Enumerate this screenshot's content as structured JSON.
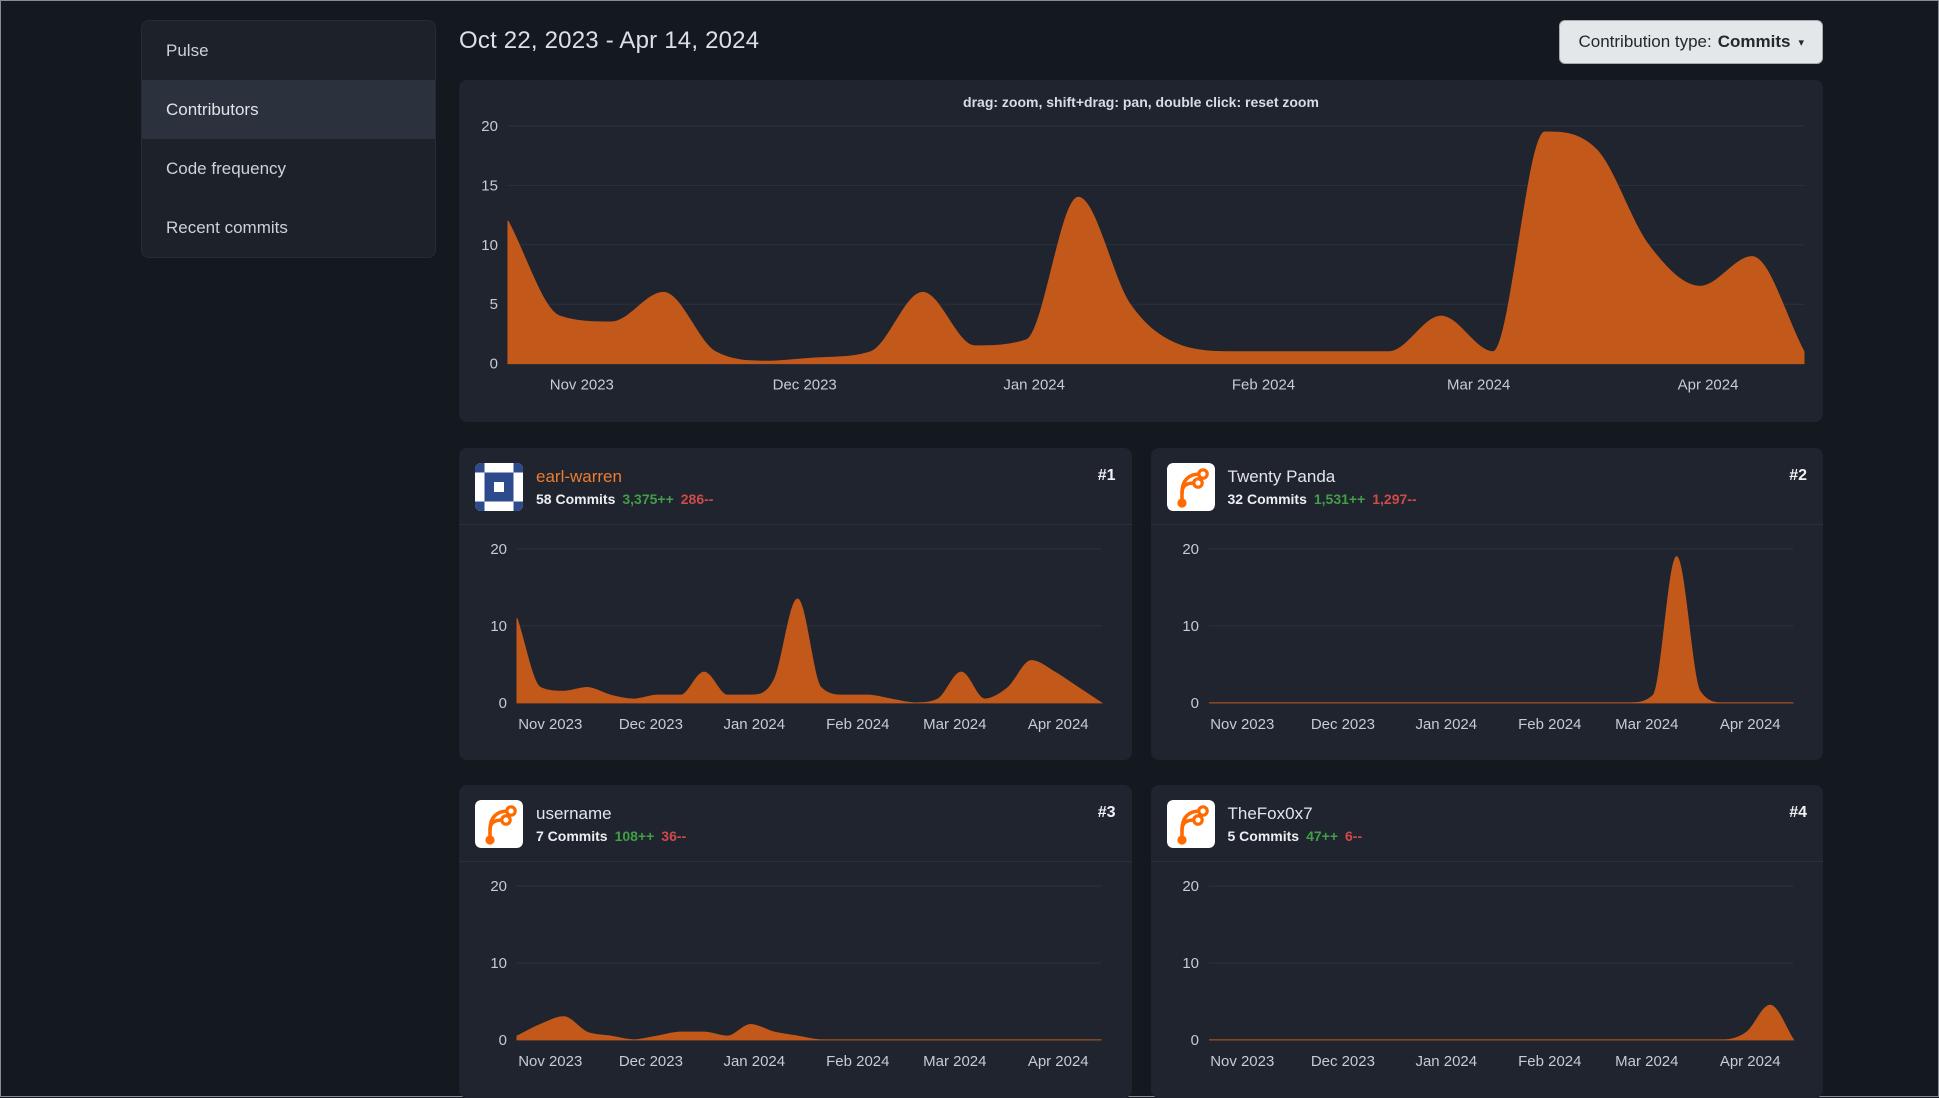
{
  "sidebar": {
    "items": [
      {
        "label": "Pulse"
      },
      {
        "label": "Contributors"
      },
      {
        "label": "Code frequency"
      },
      {
        "label": "Recent commits"
      }
    ],
    "active_item": "Contributors"
  },
  "header": {
    "date_range": "Oct 22, 2023 - Apr 14, 2024",
    "contribution_type_label": "Contribution type:",
    "contribution_type_value": "Commits"
  },
  "contributors": [
    {
      "rank": "#1",
      "name": "earl-warren",
      "commits": "58 Commits",
      "additions": "3,375++",
      "deletions": "286--"
    },
    {
      "rank": "#2",
      "name": "Twenty Panda",
      "commits": "32 Commits",
      "additions": "1,531++",
      "deletions": "1,297--"
    },
    {
      "rank": "#3",
      "name": "username",
      "commits": "7 Commits",
      "additions": "108++",
      "deletions": "36--"
    },
    {
      "rank": "#4",
      "name": "TheFox0x7",
      "commits": "5 Commits",
      "additions": "47++",
      "deletions": "6--"
    }
  ],
  "colors": {
    "page_bg": "#14181f",
    "panel_bg": "#1f242e",
    "grid": "#2c323d",
    "axis_label": "#c6ccd5",
    "chart_fill": "#c2591a",
    "accent_orange": "#ee7b2f",
    "additions_green": "#429e47",
    "deletions_red": "#d04a4a"
  },
  "chart_data": [
    {
      "id": "overall",
      "type": "area",
      "title": "Commits over time (all contributors)",
      "hint": "drag: zoom, shift+drag: pan, double click: reset zoom",
      "period": "Oct 22, 2023 - Apr 14, 2024",
      "interval": "week",
      "values": [
        12,
        4,
        3.5,
        6,
        1,
        0.2,
        0.5,
        1,
        6,
        1.5,
        2,
        14,
        5,
        1.5,
        1,
        1,
        1,
        1,
        4,
        1,
        19.5,
        18,
        10,
        6.5,
        9,
        1
      ],
      "ylim": [
        0,
        20
      ],
      "yticks": [
        0,
        5,
        10,
        15,
        20
      ],
      "xtick_labels": [
        "Nov 2023",
        "Dec 2023",
        "Jan 2024",
        "Feb 2024",
        "Mar 2024",
        "Apr 2024"
      ],
      "xtick_fractions": [
        0.057,
        0.229,
        0.406,
        0.583,
        0.749,
        0.926
      ],
      "fill_color": "#c2591a",
      "grid": true,
      "legend": "none"
    },
    {
      "id": "earl-warren",
      "type": "area",
      "title": "earl-warren weekly commits",
      "interval": "week",
      "values": [
        11,
        2,
        1.5,
        2,
        1,
        0.5,
        1,
        1,
        4,
        1,
        1,
        3,
        13.5,
        2,
        1,
        1,
        0.5,
        0,
        0.5,
        4,
        0.5,
        2,
        5.5,
        4,
        2,
        0
      ],
      "ylim": [
        0,
        20
      ],
      "yticks": [
        0,
        10,
        20
      ],
      "xtick_labels": [
        "Nov 2023",
        "Dec 2023",
        "Jan 2024",
        "Feb 2024",
        "Mar 2024",
        "Apr 2024"
      ],
      "xtick_fractions": [
        0.057,
        0.229,
        0.406,
        0.583,
        0.749,
        0.926
      ],
      "fill_color": "#c2591a",
      "grid": true,
      "legend": "none"
    },
    {
      "id": "twenty-panda",
      "type": "area",
      "title": "Twenty Panda weekly commits",
      "interval": "week",
      "values": [
        0,
        0,
        0,
        0,
        0,
        0,
        0,
        0,
        0,
        0,
        0,
        0,
        0,
        0,
        0,
        0,
        0,
        0,
        0,
        1,
        19,
        1.5,
        0,
        0,
        0,
        0
      ],
      "ylim": [
        0,
        20
      ],
      "yticks": [
        0,
        10,
        20
      ],
      "xtick_labels": [
        "Nov 2023",
        "Dec 2023",
        "Jan 2024",
        "Feb 2024",
        "Mar 2024",
        "Apr 2024"
      ],
      "xtick_fractions": [
        0.057,
        0.229,
        0.406,
        0.583,
        0.749,
        0.926
      ],
      "fill_color": "#c2591a",
      "grid": true,
      "legend": "none"
    },
    {
      "id": "username",
      "type": "area",
      "title": "username weekly commits",
      "interval": "week",
      "values": [
        0.5,
        2,
        3,
        1,
        0.5,
        0,
        0.5,
        1,
        1,
        0.5,
        2,
        1,
        0.5,
        0,
        0,
        0,
        0,
        0,
        0,
        0,
        0,
        0,
        0,
        0,
        0,
        0
      ],
      "ylim": [
        0,
        20
      ],
      "yticks": [
        0,
        10,
        20
      ],
      "xtick_labels": [
        "Nov 2023",
        "Dec 2023",
        "Jan 2024",
        "Feb 2024",
        "Mar 2024",
        "Apr 2024"
      ],
      "xtick_fractions": [
        0.057,
        0.229,
        0.406,
        0.583,
        0.749,
        0.926
      ],
      "fill_color": "#c2591a",
      "grid": true,
      "legend": "none"
    },
    {
      "id": "thefox0x7",
      "type": "area",
      "title": "TheFox0x7 weekly commits",
      "interval": "week",
      "values": [
        0,
        0,
        0,
        0,
        0,
        0,
        0,
        0,
        0,
        0,
        0,
        0,
        0,
        0,
        0,
        0,
        0,
        0,
        0,
        0,
        0,
        0,
        0,
        1,
        4.5,
        0
      ],
      "ylim": [
        0,
        20
      ],
      "yticks": [
        0,
        10,
        20
      ],
      "xtick_labels": [
        "Nov 2023",
        "Dec 2023",
        "Jan 2024",
        "Feb 2024",
        "Mar 2024",
        "Apr 2024"
      ],
      "xtick_fractions": [
        0.057,
        0.229,
        0.406,
        0.583,
        0.749,
        0.926
      ],
      "fill_color": "#c2591a",
      "grid": true,
      "legend": "none"
    }
  ]
}
